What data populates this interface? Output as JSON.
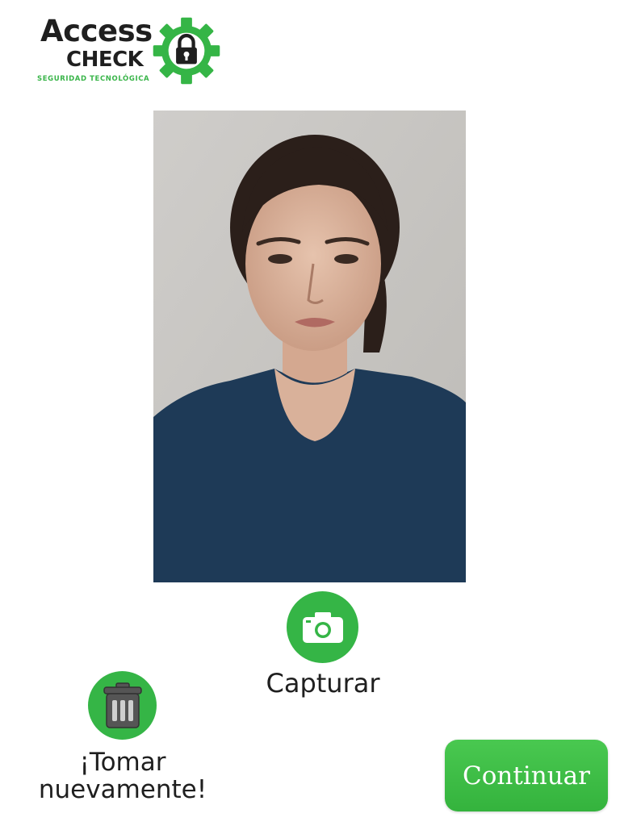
{
  "brand": {
    "line1": "Access",
    "line2": "CHECK",
    "tagline": "SEGURIDAD TECNOLÓGICA",
    "accent_color": "#35b546",
    "text_color": "#1f1f1f",
    "icon": "lock-gear-icon"
  },
  "photo": {
    "subject": "captured-face-photo"
  },
  "actions": {
    "capture_label": "Capturar",
    "capture_icon": "camera-icon",
    "retake_label": "¡Tomar nuevamente!",
    "retake_icon": "trash-icon",
    "continue_label": "Continuar"
  }
}
